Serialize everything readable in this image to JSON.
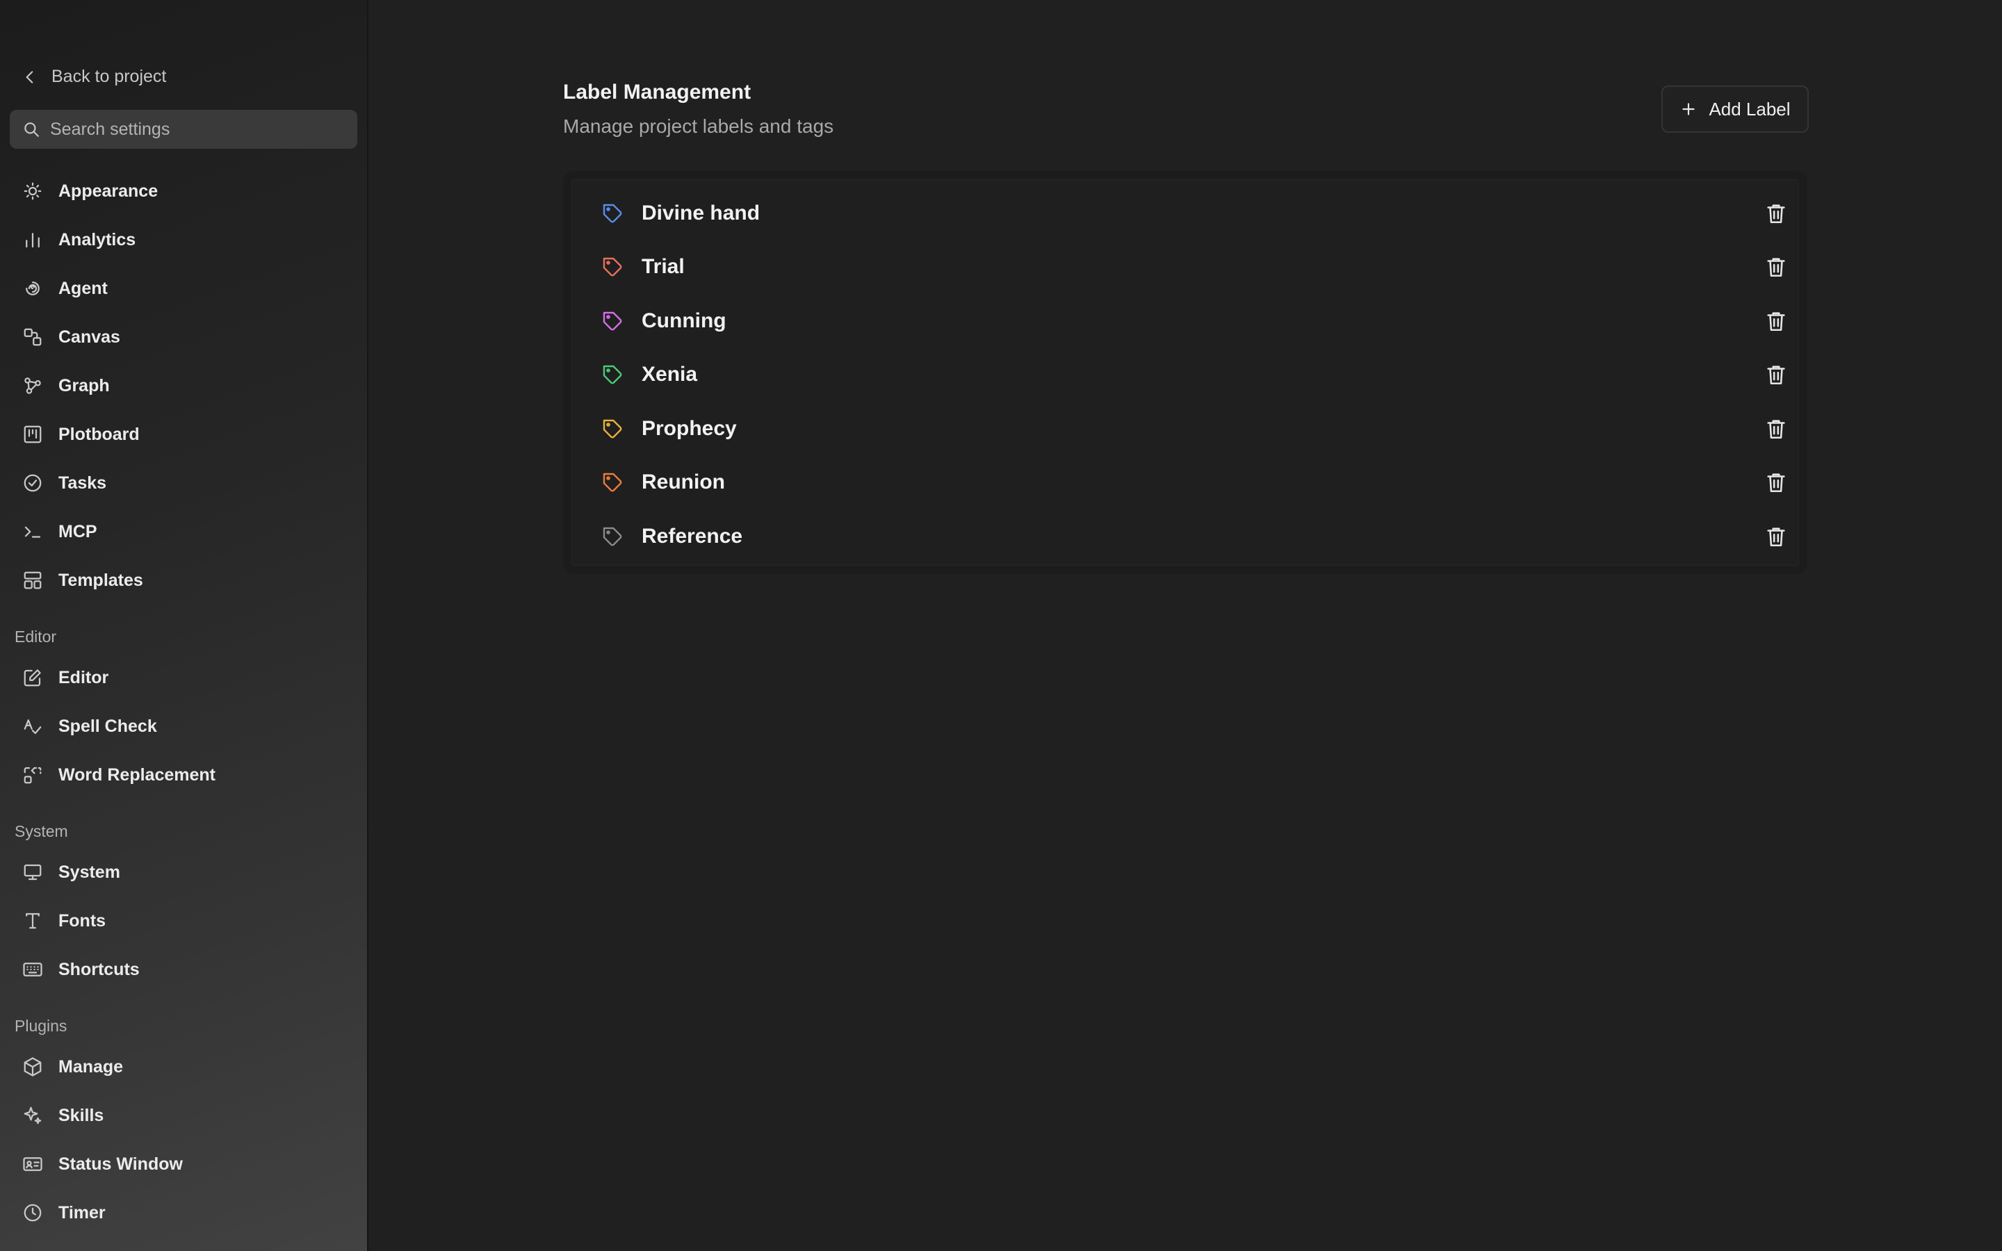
{
  "sidebar": {
    "back_label": "Back to project",
    "search_placeholder": "Search settings",
    "general_items": [
      {
        "label": "Appearance",
        "icon": "sun-icon"
      },
      {
        "label": "Analytics",
        "icon": "bar-chart-icon"
      },
      {
        "label": "Agent",
        "icon": "spiral-icon"
      },
      {
        "label": "Canvas",
        "icon": "shapes-icon"
      },
      {
        "label": "Graph",
        "icon": "graph-icon"
      },
      {
        "label": "Plotboard",
        "icon": "kanban-icon"
      },
      {
        "label": "Tasks",
        "icon": "check-circle-icon"
      },
      {
        "label": "MCP",
        "icon": "terminal-icon"
      },
      {
        "label": "Templates",
        "icon": "layout-template-icon"
      }
    ],
    "editor_section": "Editor",
    "editor_items": [
      {
        "label": "Editor",
        "icon": "edit-icon"
      },
      {
        "label": "Spell Check",
        "icon": "spell-check-icon"
      },
      {
        "label": "Word Replacement",
        "icon": "replace-icon"
      }
    ],
    "system_section": "System",
    "system_items": [
      {
        "label": "System",
        "icon": "monitor-icon"
      },
      {
        "label": "Fonts",
        "icon": "type-icon"
      },
      {
        "label": "Shortcuts",
        "icon": "keyboard-icon"
      }
    ],
    "plugins_section": "Plugins",
    "plugin_items": [
      {
        "label": "Manage",
        "icon": "package-icon"
      },
      {
        "label": "Skills",
        "icon": "sparkles-icon"
      },
      {
        "label": "Status Window",
        "icon": "id-card-icon"
      },
      {
        "label": "Timer",
        "icon": "clock-icon"
      }
    ]
  },
  "main": {
    "title": "Label Management",
    "subtitle": "Manage project labels and tags",
    "add_button": "Add Label",
    "labels": [
      {
        "name": "Divine hand",
        "color": "#5b8def"
      },
      {
        "name": "Trial",
        "color": "#e8705f"
      },
      {
        "name": "Cunning",
        "color": "#d66ee8"
      },
      {
        "name": "Xenia",
        "color": "#4fc979"
      },
      {
        "name": "Prophecy",
        "color": "#e8b23a"
      },
      {
        "name": "Reunion",
        "color": "#ee7b3e"
      },
      {
        "name": "Reference",
        "color": "#8a8a8a"
      }
    ]
  },
  "colors": {
    "background": "#202020",
    "icon": "#c8c8c8"
  }
}
